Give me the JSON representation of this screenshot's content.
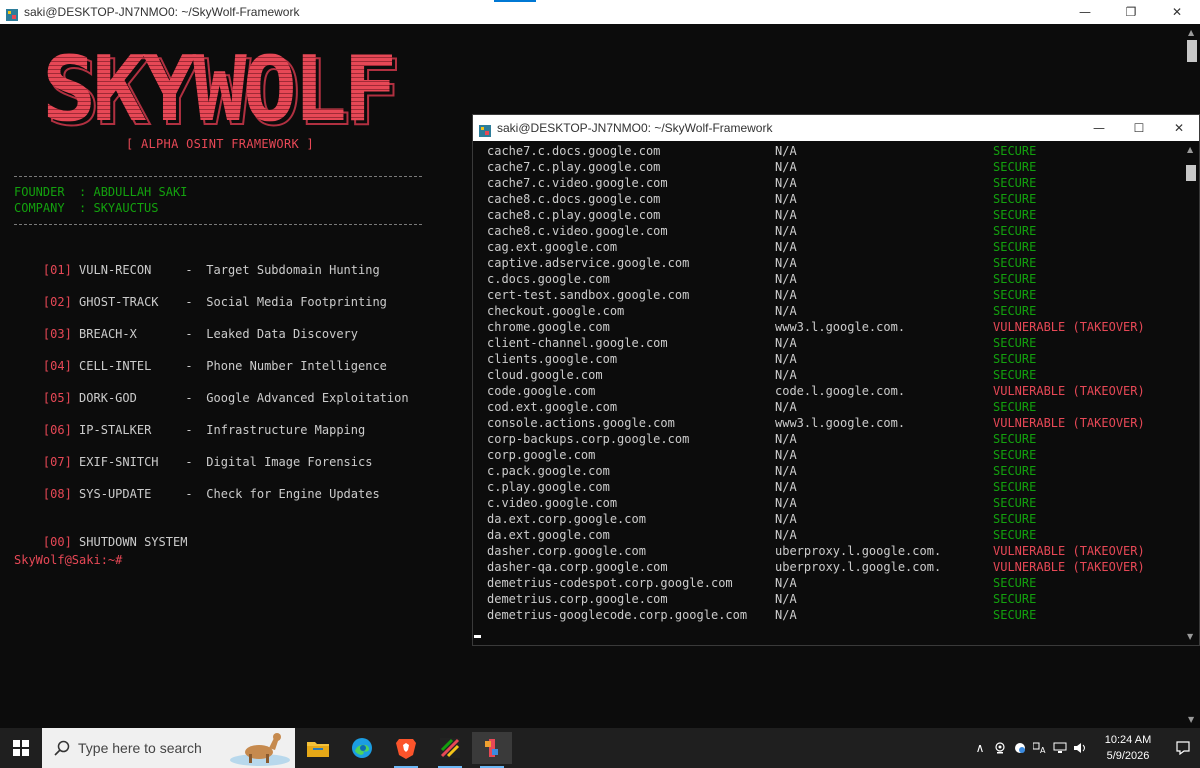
{
  "back_window": {
    "title": "saki@DESKTOP-JN7NMO0: ~/SkyWolf-Framework",
    "controls": {
      "minimize": "—",
      "maximize": "❐",
      "close": "✕"
    },
    "banner_text": "SKYWOLF",
    "tagline": "[ ALPHA OSINT FRAMEWORK ]",
    "founder_line": "FOUNDER  : ABDULLAH SAKI",
    "company_line": "COMPANY  : SKYAUCTUS",
    "menu": [
      {
        "num": "[01]",
        "name": "VULN-RECON",
        "desc": "Target Subdomain Hunting"
      },
      {
        "num": "[02]",
        "name": "GHOST-TRACK",
        "desc": "Social Media Footprinting"
      },
      {
        "num": "[03]",
        "name": "BREACH-X",
        "desc": "Leaked Data Discovery"
      },
      {
        "num": "[04]",
        "name": "CELL-INTEL",
        "desc": "Phone Number Intelligence"
      },
      {
        "num": "[05]",
        "name": "DORK-GOD",
        "desc": "Google Advanced Exploitation"
      },
      {
        "num": "[06]",
        "name": "IP-STALKER",
        "desc": "Infrastructure Mapping"
      },
      {
        "num": "[07]",
        "name": "EXIF-SNITCH",
        "desc": "Digital Image Forensics"
      },
      {
        "num": "[08]",
        "name": "SYS-UPDATE",
        "desc": "Check for Engine Updates"
      }
    ],
    "shutdown": {
      "num": "[00]",
      "name": "SHUTDOWN SYSTEM"
    },
    "prompt": "SkyWolf@Saki:~#",
    "scroll_up": "▲",
    "scroll_down": "▼"
  },
  "front_window": {
    "title": "saki@DESKTOP-JN7NMO0: ~/SkyWolf-Framework",
    "controls": {
      "minimize": "—",
      "maximize": "☐",
      "close": "✕"
    },
    "results": [
      {
        "host": "cache7.c.docs.google.com",
        "cname": "N/A",
        "status": "SECURE"
      },
      {
        "host": "cache7.c.play.google.com",
        "cname": "N/A",
        "status": "SECURE"
      },
      {
        "host": "cache7.c.video.google.com",
        "cname": "N/A",
        "status": "SECURE"
      },
      {
        "host": "cache8.c.docs.google.com",
        "cname": "N/A",
        "status": "SECURE"
      },
      {
        "host": "cache8.c.play.google.com",
        "cname": "N/A",
        "status": "SECURE"
      },
      {
        "host": "cache8.c.video.google.com",
        "cname": "N/A",
        "status": "SECURE"
      },
      {
        "host": "cag.ext.google.com",
        "cname": "N/A",
        "status": "SECURE"
      },
      {
        "host": "captive.adservice.google.com",
        "cname": "N/A",
        "status": "SECURE"
      },
      {
        "host": "c.docs.google.com",
        "cname": "N/A",
        "status": "SECURE"
      },
      {
        "host": "cert-test.sandbox.google.com",
        "cname": "N/A",
        "status": "SECURE"
      },
      {
        "host": "checkout.google.com",
        "cname": "N/A",
        "status": "SECURE"
      },
      {
        "host": "chrome.google.com",
        "cname": "www3.l.google.com.",
        "status": "VULNERABLE (TAKEOVER)"
      },
      {
        "host": "client-channel.google.com",
        "cname": "N/A",
        "status": "SECURE"
      },
      {
        "host": "clients.google.com",
        "cname": "N/A",
        "status": "SECURE"
      },
      {
        "host": "cloud.google.com",
        "cname": "N/A",
        "status": "SECURE"
      },
      {
        "host": "code.google.com",
        "cname": "code.l.google.com.",
        "status": "VULNERABLE (TAKEOVER)"
      },
      {
        "host": "cod.ext.google.com",
        "cname": "N/A",
        "status": "SECURE"
      },
      {
        "host": "console.actions.google.com",
        "cname": "www3.l.google.com.",
        "status": "VULNERABLE (TAKEOVER)"
      },
      {
        "host": "corp-backups.corp.google.com",
        "cname": "N/A",
        "status": "SECURE"
      },
      {
        "host": "corp.google.com",
        "cname": "N/A",
        "status": "SECURE"
      },
      {
        "host": "c.pack.google.com",
        "cname": "N/A",
        "status": "SECURE"
      },
      {
        "host": "c.play.google.com",
        "cname": "N/A",
        "status": "SECURE"
      },
      {
        "host": "c.video.google.com",
        "cname": "N/A",
        "status": "SECURE"
      },
      {
        "host": "da.ext.corp.google.com",
        "cname": "N/A",
        "status": "SECURE"
      },
      {
        "host": "da.ext.google.com",
        "cname": "N/A",
        "status": "SECURE"
      },
      {
        "host": "dasher.corp.google.com",
        "cname": "uberproxy.l.google.com.",
        "status": "VULNERABLE (TAKEOVER)"
      },
      {
        "host": "dasher-qa.corp.google.com",
        "cname": "uberproxy.l.google.com.",
        "status": "VULNERABLE (TAKEOVER)"
      },
      {
        "host": "demetrius-codespot.corp.google.com",
        "cname": "N/A",
        "status": "SECURE"
      },
      {
        "host": "demetrius.corp.google.com",
        "cname": "N/A",
        "status": "SECURE"
      },
      {
        "host": "demetrius-googlecode.corp.google.com",
        "cname": "N/A",
        "status": "SECURE"
      }
    ],
    "scroll_up": "▲",
    "scroll_down": "▼"
  },
  "taskbar": {
    "search_placeholder": "Type here to search",
    "apps": [
      "windows-start-icon",
      "file-explorer-icon",
      "edge-icon",
      "brave-icon",
      "wsl-icon",
      "git-icon"
    ],
    "tray": {
      "chevron": "∧",
      "time": "10:24 AM",
      "date": "5/9/2026"
    }
  }
}
